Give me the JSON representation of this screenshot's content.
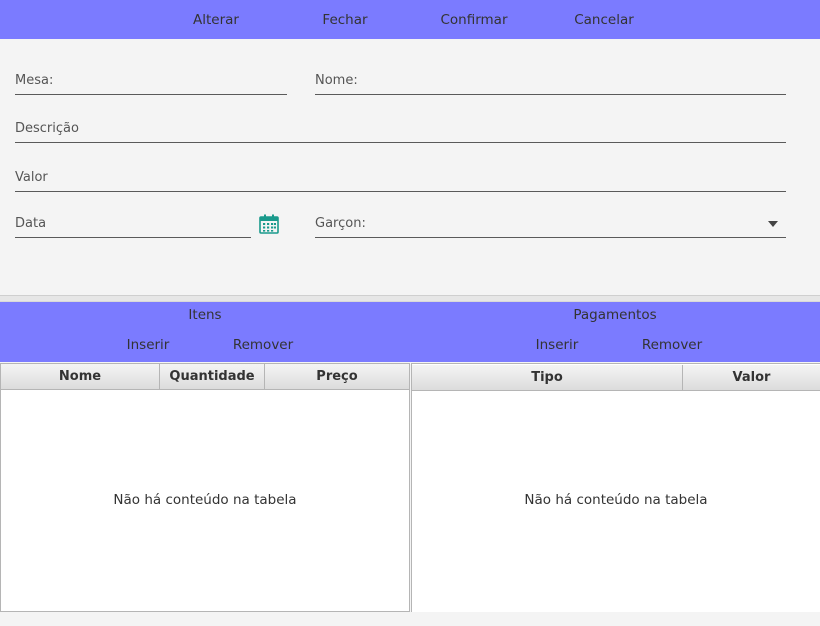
{
  "toolbar": {
    "alterar": "Alterar",
    "fechar": "Fechar",
    "confirmar": "Confirmar",
    "cancelar": "Cancelar"
  },
  "form": {
    "mesa_label": "Mesa:",
    "nome_label": "Nome:",
    "descricao_label": "Descrição",
    "valor_label": "Valor",
    "data_label": "Data",
    "garcom_label": "Garçon:",
    "calendar_icon": "calendar-icon",
    "dropdown_icon": "chevron-down-icon"
  },
  "itens": {
    "title": "Itens",
    "inserir": "Inserir",
    "remover": "Remover",
    "columns": [
      "Nome",
      "Quantidade",
      "Preço"
    ],
    "empty": "Não há conteúdo na tabela"
  },
  "pagamentos": {
    "title": "Pagamentos",
    "inserir": "Inserir",
    "remover": "Remover",
    "columns": [
      "Tipo",
      "Valor"
    ],
    "empty": "Não há conteúdo na tabela"
  },
  "colors": {
    "accent": "#7b7bff",
    "background": "#f4f4f4",
    "calendar": "#1a9a8c"
  }
}
